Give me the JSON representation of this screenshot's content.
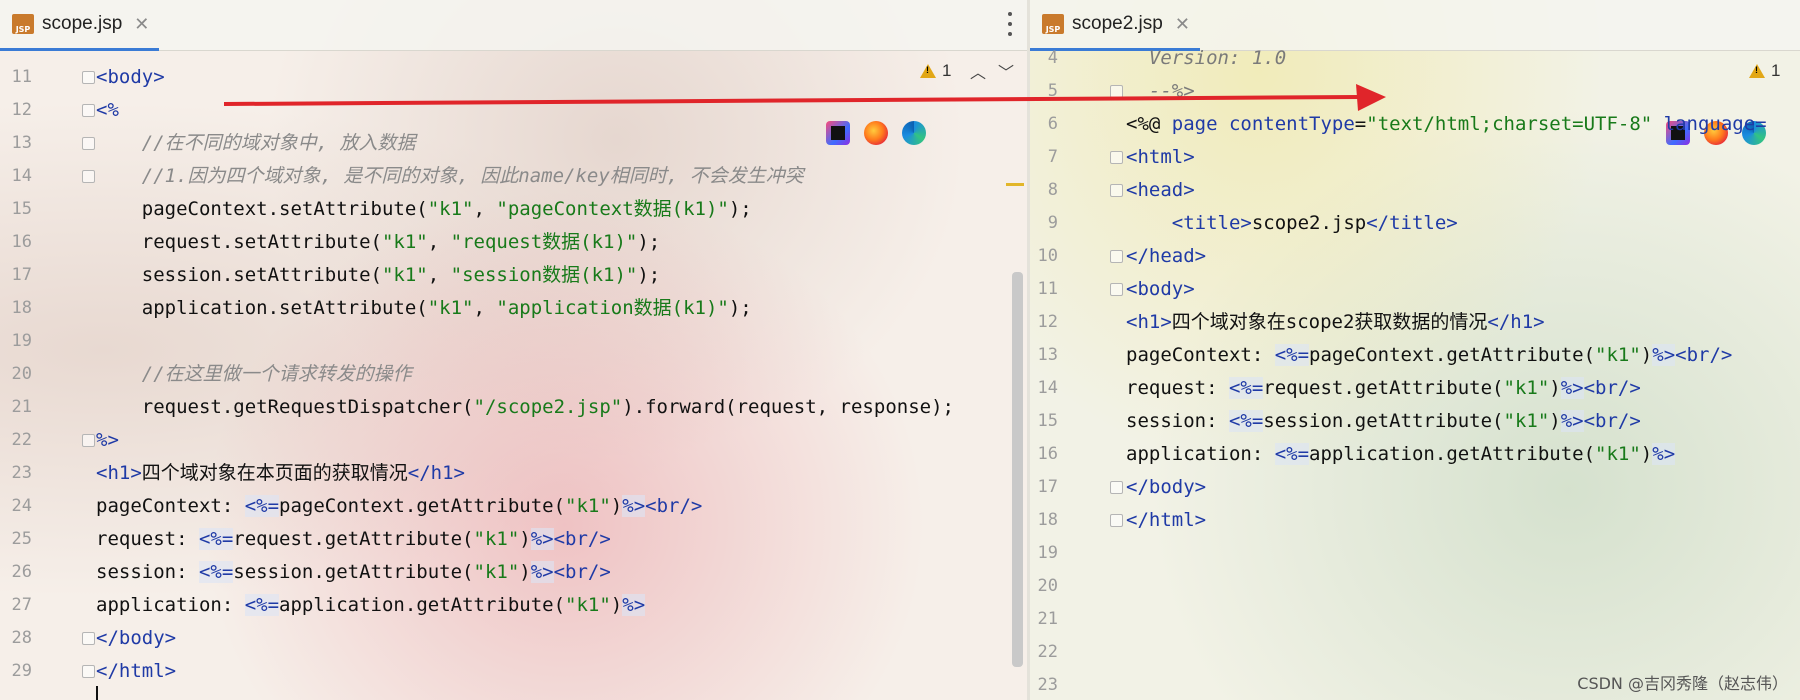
{
  "left_pane": {
    "tab": {
      "icon_label": "JSP",
      "title": "scope.jsp"
    },
    "warnings": {
      "count": "1"
    },
    "lines": [
      {
        "n": "11",
        "segments": [
          {
            "t": "<",
            "c": "tag"
          },
          {
            "t": "body",
            "c": "tag"
          },
          {
            "t": ">",
            "c": "tag"
          }
        ]
      },
      {
        "n": "12",
        "segments": [
          {
            "t": "<%",
            "c": "tag"
          }
        ]
      },
      {
        "n": "13",
        "segments": [
          {
            "t": "    //在不同的域对象中, 放入数据",
            "c": "cmt"
          }
        ]
      },
      {
        "n": "14",
        "segments": [
          {
            "t": "    //1.因为四个域对象, 是不同的对象, 因此name/key相同时, 不会发生冲突",
            "c": "cmt"
          }
        ]
      },
      {
        "n": "15",
        "segments": [
          {
            "t": "    pageContext.setAttribute(",
            "c": ""
          },
          {
            "t": "\"k1\"",
            "c": "str"
          },
          {
            "t": ", ",
            "c": ""
          },
          {
            "t": "\"pageContext数据(k1)\"",
            "c": "str"
          },
          {
            "t": ");",
            "c": ""
          }
        ]
      },
      {
        "n": "16",
        "segments": [
          {
            "t": "    request.setAttribute(",
            "c": ""
          },
          {
            "t": "\"k1\"",
            "c": "str"
          },
          {
            "t": ", ",
            "c": ""
          },
          {
            "t": "\"request数据(k1)\"",
            "c": "str"
          },
          {
            "t": ");",
            "c": ""
          }
        ]
      },
      {
        "n": "17",
        "segments": [
          {
            "t": "    session.setAttribute(",
            "c": ""
          },
          {
            "t": "\"k1\"",
            "c": "str"
          },
          {
            "t": ", ",
            "c": ""
          },
          {
            "t": "\"session数据(k1)\"",
            "c": "str"
          },
          {
            "t": ");",
            "c": ""
          }
        ]
      },
      {
        "n": "18",
        "segments": [
          {
            "t": "    application.setAttribute(",
            "c": ""
          },
          {
            "t": "\"k1\"",
            "c": "str"
          },
          {
            "t": ", ",
            "c": ""
          },
          {
            "t": "\"application数据(k1)\"",
            "c": "str"
          },
          {
            "t": ");",
            "c": ""
          }
        ]
      },
      {
        "n": "19",
        "segments": []
      },
      {
        "n": "20",
        "segments": [
          {
            "t": "    //在这里做一个请求转发的操作",
            "c": "cmt"
          }
        ]
      },
      {
        "n": "21",
        "segments": [
          {
            "t": "    request.getRequestDispatcher(",
            "c": ""
          },
          {
            "t": "\"/scope2.jsp\"",
            "c": "str"
          },
          {
            "t": ").forward(request, response);",
            "c": ""
          }
        ]
      },
      {
        "n": "22",
        "segments": [
          {
            "t": "%>",
            "c": "tag"
          }
        ]
      },
      {
        "n": "23",
        "segments": [
          {
            "t": "<h1>",
            "c": "tag"
          },
          {
            "t": "四个域对象在本页面的获取情况",
            "c": ""
          },
          {
            "t": "</h1>",
            "c": "tag"
          }
        ]
      },
      {
        "n": "24",
        "segments": [
          {
            "t": "pageContext: ",
            "c": ""
          },
          {
            "t": "<%=",
            "c": "jsp"
          },
          {
            "t": "pageContext.getAttribute(",
            "c": ""
          },
          {
            "t": "\"k1\"",
            "c": "str"
          },
          {
            "t": ")",
            "c": ""
          },
          {
            "t": "%>",
            "c": "jsp"
          },
          {
            "t": "<br/>",
            "c": "tag"
          }
        ]
      },
      {
        "n": "25",
        "segments": [
          {
            "t": "request: ",
            "c": ""
          },
          {
            "t": "<%=",
            "c": "jsp"
          },
          {
            "t": "request.getAttribute(",
            "c": ""
          },
          {
            "t": "\"k1\"",
            "c": "str"
          },
          {
            "t": ")",
            "c": ""
          },
          {
            "t": "%>",
            "c": "jsp"
          },
          {
            "t": "<br/>",
            "c": "tag"
          }
        ]
      },
      {
        "n": "26",
        "segments": [
          {
            "t": "session: ",
            "c": ""
          },
          {
            "t": "<%=",
            "c": "jsp"
          },
          {
            "t": "session.getAttribute(",
            "c": ""
          },
          {
            "t": "\"k1\"",
            "c": "str"
          },
          {
            "t": ")",
            "c": ""
          },
          {
            "t": "%>",
            "c": "jsp"
          },
          {
            "t": "<br/>",
            "c": "tag"
          }
        ]
      },
      {
        "n": "27",
        "segments": [
          {
            "t": "application: ",
            "c": ""
          },
          {
            "t": "<%=",
            "c": "jsp"
          },
          {
            "t": "application.getAttribute(",
            "c": ""
          },
          {
            "t": "\"k1\"",
            "c": "str"
          },
          {
            "t": ")",
            "c": ""
          },
          {
            "t": "%>",
            "c": "jsp"
          }
        ]
      },
      {
        "n": "28",
        "segments": [
          {
            "t": "</body>",
            "c": "tag"
          }
        ]
      },
      {
        "n": "29",
        "segments": [
          {
            "t": "</html>",
            "c": "tag"
          }
        ]
      }
    ]
  },
  "right_pane": {
    "tab": {
      "icon_label": "JSP",
      "title": "scope2.jsp"
    },
    "warnings": {
      "count": "1"
    },
    "lines": [
      {
        "n": "4",
        "segments": [
          {
            "t": "  Version: 1.0",
            "c": "dim"
          }
        ]
      },
      {
        "n": "5",
        "segments": [
          {
            "t": "  --%>",
            "c": "dim"
          }
        ]
      },
      {
        "n": "6",
        "segments": [
          {
            "t": "<%@ ",
            "c": ""
          },
          {
            "t": "page contentType",
            "c": "tag"
          },
          {
            "t": "=",
            "c": ""
          },
          {
            "t": "\"text/html;charset=UTF-8\"",
            "c": "str"
          },
          {
            "t": " language=",
            "c": "tag"
          }
        ]
      },
      {
        "n": "7",
        "segments": [
          {
            "t": "<html>",
            "c": "tag"
          }
        ]
      },
      {
        "n": "8",
        "segments": [
          {
            "t": "<head>",
            "c": "tag"
          }
        ]
      },
      {
        "n": "9",
        "segments": [
          {
            "t": "    <title>",
            "c": "tag"
          },
          {
            "t": "scope2.jsp",
            "c": ""
          },
          {
            "t": "</title>",
            "c": "tag"
          }
        ]
      },
      {
        "n": "10",
        "segments": [
          {
            "t": "</head>",
            "c": "tag"
          }
        ]
      },
      {
        "n": "11",
        "segments": [
          {
            "t": "<body>",
            "c": "tag"
          }
        ]
      },
      {
        "n": "12",
        "segments": [
          {
            "t": "<h1>",
            "c": "tag"
          },
          {
            "t": "四个域对象在scope2获取数据的情况",
            "c": ""
          },
          {
            "t": "</h1>",
            "c": "tag"
          }
        ]
      },
      {
        "n": "13",
        "segments": [
          {
            "t": "pageContext: ",
            "c": ""
          },
          {
            "t": "<%=",
            "c": "jsp"
          },
          {
            "t": "pageContext.getAttribute(",
            "c": ""
          },
          {
            "t": "\"k1\"",
            "c": "str"
          },
          {
            "t": ")",
            "c": ""
          },
          {
            "t": "%>",
            "c": "jsp"
          },
          {
            "t": "<br/>",
            "c": "tag"
          }
        ]
      },
      {
        "n": "14",
        "segments": [
          {
            "t": "request: ",
            "c": ""
          },
          {
            "t": "<%=",
            "c": "jsp"
          },
          {
            "t": "request.getAttribute(",
            "c": ""
          },
          {
            "t": "\"k1\"",
            "c": "str"
          },
          {
            "t": ")",
            "c": ""
          },
          {
            "t": "%>",
            "c": "jsp"
          },
          {
            "t": "<br/>",
            "c": "tag"
          }
        ]
      },
      {
        "n": "15",
        "segments": [
          {
            "t": "session: ",
            "c": ""
          },
          {
            "t": "<%=",
            "c": "jsp"
          },
          {
            "t": "session.getAttribute(",
            "c": ""
          },
          {
            "t": "\"k1\"",
            "c": "str"
          },
          {
            "t": ")",
            "c": ""
          },
          {
            "t": "%>",
            "c": "jsp"
          },
          {
            "t": "<br/>",
            "c": "tag"
          }
        ]
      },
      {
        "n": "16",
        "segments": [
          {
            "t": "application: ",
            "c": ""
          },
          {
            "t": "<%=",
            "c": "jsp"
          },
          {
            "t": "application.getAttribute(",
            "c": ""
          },
          {
            "t": "\"k1\"",
            "c": "str"
          },
          {
            "t": ")",
            "c": ""
          },
          {
            "t": "%>",
            "c": "jsp"
          }
        ]
      },
      {
        "n": "17",
        "segments": [
          {
            "t": "</body>",
            "c": "tag"
          }
        ]
      },
      {
        "n": "18",
        "segments": [
          {
            "t": "</html>",
            "c": "tag"
          }
        ]
      },
      {
        "n": "19",
        "segments": []
      },
      {
        "n": "20",
        "segments": []
      },
      {
        "n": "21",
        "segments": []
      },
      {
        "n": "22",
        "segments": []
      },
      {
        "n": "23",
        "segments": []
      }
    ]
  },
  "watermark": "CSDN @吉冈秀隆（赵志伟）",
  "colors": {
    "arrow": "#e0252a",
    "tab_underline": "#3a7bd5",
    "warning": "#e2a716"
  }
}
